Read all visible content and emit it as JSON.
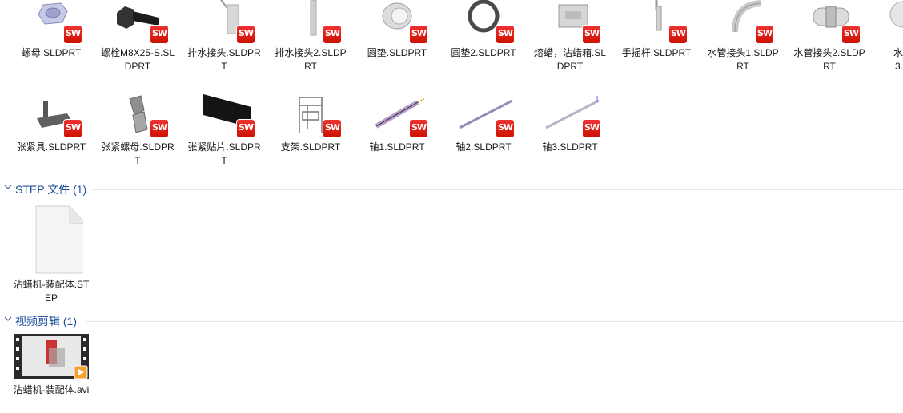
{
  "colors": {
    "group_title": "#1e4e9a",
    "sw_badge": "#d01010",
    "divider": "#e5e5e5"
  },
  "row1": [
    {
      "label": "螺母.SLDPRT",
      "icon": "hex-nut-icon"
    },
    {
      "label": "螺栓M8X25-S.SLDPRT",
      "icon": "bolt-icon"
    },
    {
      "label": "排水接头.SLDPRT",
      "icon": "drain-fitting-icon"
    },
    {
      "label": "排水接头2.SLDPRT",
      "icon": "drain-rod-icon"
    },
    {
      "label": "圆垫.SLDPRT",
      "icon": "round-washer-icon"
    },
    {
      "label": "圆垫2.SLDPRT",
      "icon": "ring-icon"
    },
    {
      "label": "熔蜡，沾蜡箱.SLDPRT",
      "icon": "wax-tank-icon"
    },
    {
      "label": "手摇杆.SLDPRT",
      "icon": "crank-icon"
    },
    {
      "label": "水管接头1.SLDPRT",
      "icon": "pipe-elbow-icon"
    },
    {
      "label": "水管接头2.SLDPRT",
      "icon": "pipe-coupling-icon"
    },
    {
      "label": "水",
      "label2": "3.",
      "icon": "partial-icon"
    }
  ],
  "row2": [
    {
      "label": "张紧具.SLDPRT",
      "icon": "tensioner-icon"
    },
    {
      "label": "张紧螺母.SLDPRT",
      "icon": "tension-nut-icon"
    },
    {
      "label": "张紧贴片.SLDPRT",
      "icon": "tension-plate-icon"
    },
    {
      "label": "支架.SLDPRT",
      "icon": "frame-icon"
    },
    {
      "label": "轴1.SLDPRT",
      "icon": "shaft1-icon"
    },
    {
      "label": "轴2.SLDPRT",
      "icon": "shaft2-icon"
    },
    {
      "label": "轴3.SLDPRT",
      "icon": "shaft3-icon"
    }
  ],
  "badge_text": "SW",
  "groups": {
    "step": {
      "title": "STEP 文件 (1)",
      "file_label": "沾蜡机-装配体.STEP"
    },
    "video": {
      "title": "视频剪辑 (1)",
      "file_label": "沾蜡机-装配体.avi"
    }
  }
}
